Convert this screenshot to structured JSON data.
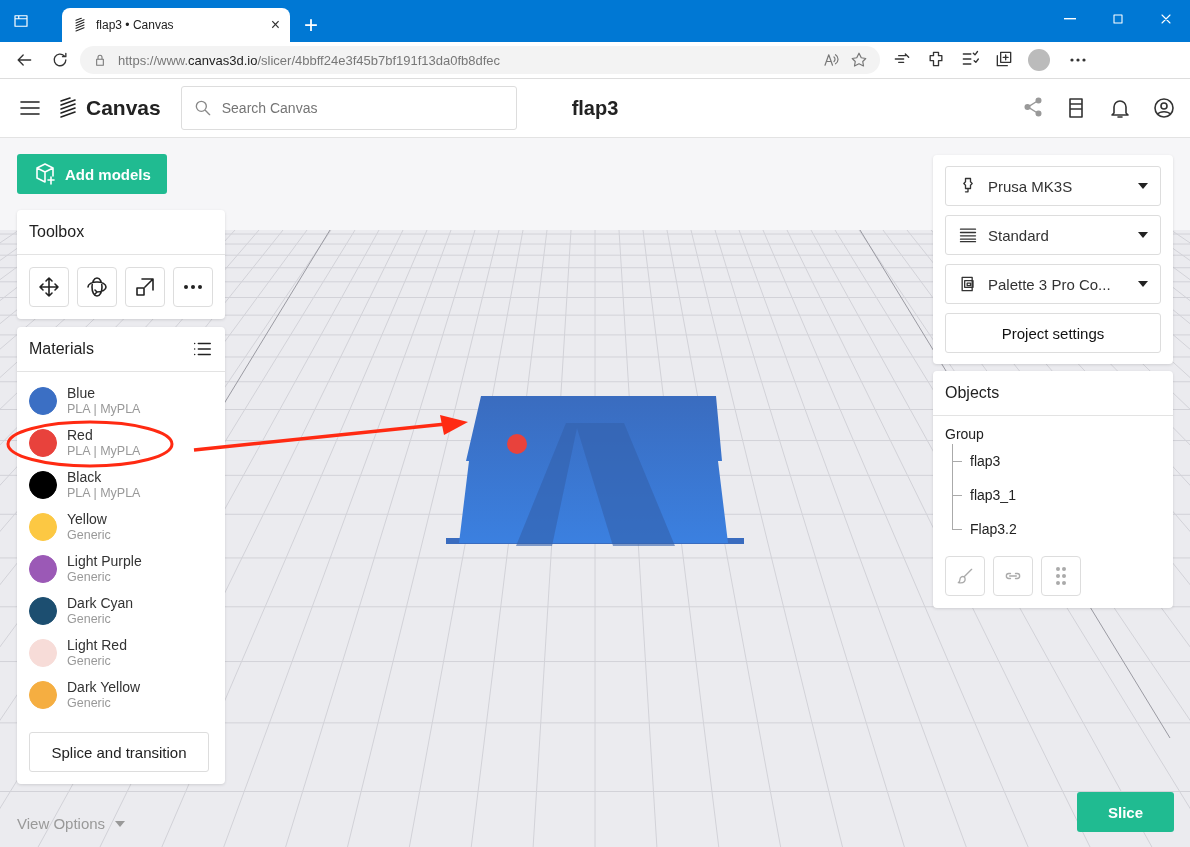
{
  "browser": {
    "tab_title": "flap3 • Canvas",
    "tab_close": "×",
    "new_tab": "+",
    "url": {
      "prefix": "https://www.",
      "domain": "canvas3d.io",
      "path": "/slicer/4bbff24e3f45b7bf191f13da0fb8dfec"
    }
  },
  "header": {
    "logo": "Canvas",
    "search": {
      "placeholder": "Search Canvas"
    },
    "title": "flap3"
  },
  "add_models": "Add models",
  "toolbox": {
    "title": "Toolbox",
    "tools": [
      {
        "kind": "move"
      },
      {
        "kind": "rotate"
      },
      {
        "kind": "scale"
      },
      {
        "kind": "more"
      }
    ]
  },
  "materials": {
    "title": "Materials",
    "items": [
      {
        "name": "Blue",
        "detail": "PLA | MyPLA",
        "color": "#3b6fc4"
      },
      {
        "name": "Red",
        "detail": "PLA | MyPLA",
        "color": "#e8423c"
      },
      {
        "name": "Black",
        "detail": "PLA | MyPLA",
        "color": "#000000"
      },
      {
        "name": "Yellow",
        "detail": "Generic",
        "color": "#fcc843"
      },
      {
        "name": "Light Purple",
        "detail": "Generic",
        "color": "#9b59b6"
      },
      {
        "name": "Dark Cyan",
        "detail": "Generic",
        "color": "#1c4e70"
      },
      {
        "name": "Light Red",
        "detail": "Generic",
        "color": "#f7dcd8"
      },
      {
        "name": "Dark Yellow",
        "detail": "Generic",
        "color": "#f5ae41"
      }
    ],
    "button": "Splice and transition"
  },
  "settings": {
    "dropdowns": [
      {
        "kind": "printer",
        "label": "Prusa MK3S"
      },
      {
        "kind": "profile",
        "label": "Standard"
      },
      {
        "kind": "device",
        "label": "Palette 3 Pro Co..."
      }
    ],
    "button": "Project settings"
  },
  "objects": {
    "title": "Objects",
    "tree": [
      {
        "label": "Group",
        "children": [
          {
            "label": "flap3"
          },
          {
            "label": "flap3_1"
          },
          {
            "label": "Flap3.2"
          }
        ]
      }
    ],
    "actions": [
      {
        "kind": "paint"
      },
      {
        "kind": "link"
      },
      {
        "kind": "grip"
      }
    ]
  },
  "view_options": "View Options",
  "slice": "Slice"
}
